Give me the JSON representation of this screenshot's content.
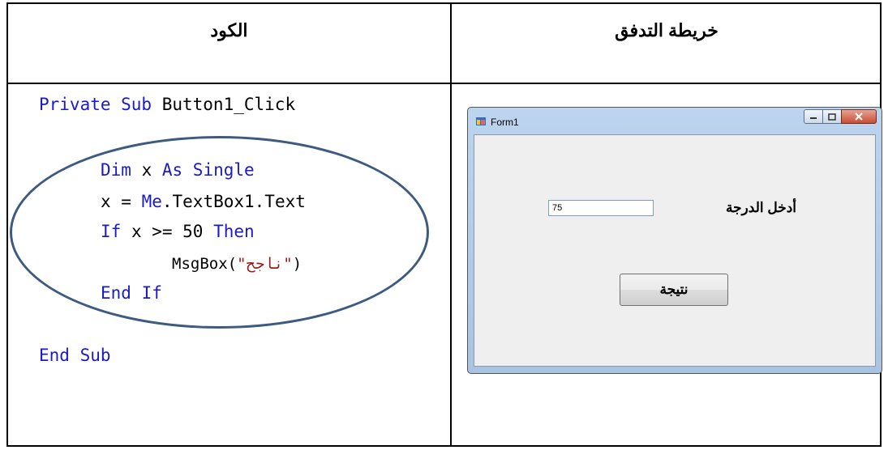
{
  "headers": {
    "code": "الكود",
    "flowchart": "خريطة التدفق"
  },
  "code": {
    "line1_kw": "Private Sub",
    "line1_rest": " Button1_Click",
    "line2_kw1": "Dim",
    "line2_var": " x ",
    "line2_kw2": "As Single",
    "line3_a": "x = ",
    "line3_kw": "Me",
    "line3_b": ".TextBox1.Text",
    "line4_kw1": "If",
    "line4_mid": " x >= 50 ",
    "line4_kw2": "Then",
    "line5_a": "MsgBox(",
    "line5_str": "\"ناجح\"",
    "line5_b": ")",
    "line6_kw": "End If",
    "line7_kw": "End Sub"
  },
  "colors": {
    "keyword": "#1a1acc",
    "string": "#9a1b1b",
    "oval_border": "#3d5a80"
  },
  "form": {
    "title": "Form1",
    "grade_label": "أدخل الدرجة",
    "textbox_value": "75",
    "button_label": "نتيجة"
  },
  "icons": [
    "app-icon",
    "minimize-icon",
    "maximize-icon",
    "close-icon"
  ]
}
